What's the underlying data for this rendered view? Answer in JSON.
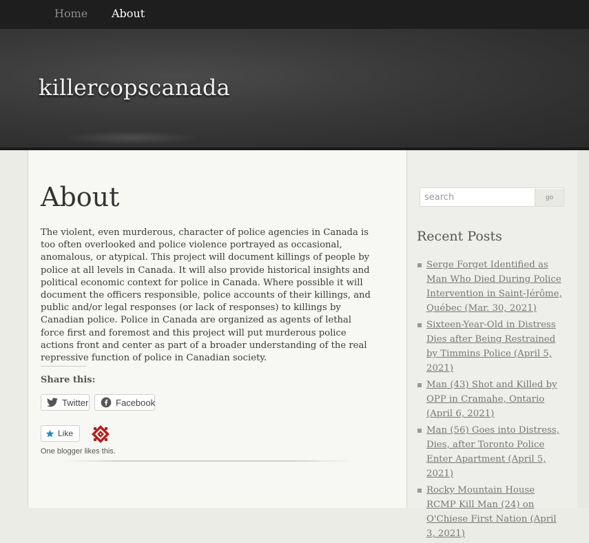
{
  "nav": {
    "items": [
      {
        "label": "Home"
      },
      {
        "label": "About"
      }
    ]
  },
  "header": {
    "site_title": "killercopscanada"
  },
  "main": {
    "page_title": "About",
    "body": "The violent, even murderous, character of police agencies in Canada is too often overlooked and police violence portrayed as occasional, anomalous, or atypical. This project will document killings of people by police at all levels in Canada. It will also provide historical insights and political economic context for police in Canada. Where possible it will document the officers responsible, police accounts of their killings, and public and/or legal responses (or lack of responses) to killings by Canadian police. Police in Canada are organized as agents of lethal force first and foremost and this project will put murderous police actions front and center as part of a broader understanding of the real repressive function of police in Canadian society.",
    "share": {
      "title": "Share this:",
      "twitter_label": "Twitter",
      "facebook_label": "Facebook"
    },
    "like": {
      "button_label": "Like",
      "likes_text": "One blogger likes this."
    }
  },
  "sidebar": {
    "search": {
      "placeholder": "search",
      "button_label": "go"
    },
    "recent_posts": {
      "title": "Recent Posts",
      "items": [
        {
          "label": "Serge Forget Identified as Man Who Died During Police Intervention in Saint-Jérôme, Québec (Mar. 30, 2021)"
        },
        {
          "label": "Sixteen-Year-Old in Distress Dies after Being Restrained by Timmins Police (April 5, 2021)"
        },
        {
          "label": "Man (43) Shot and Killed by OPP in Cramahe, Ontario (April 6, 2021)"
        },
        {
          "label": "Man (56) Goes into Distress, Dies, after Toronto Police Enter Apartment (April 5, 2021)"
        },
        {
          "label": "Rocky Mountain House RCMP Kill Man (24) on O'Chiese First Nation (April 3, 2021)"
        }
      ]
    }
  },
  "colors": {
    "nav_bg": "#1e1e1e",
    "header_bg": "#3a3a3a",
    "content_bg": "#f7f7f4",
    "link": "#777777",
    "twitter_icon": "#555555",
    "facebook_icon": "#555555",
    "like_star": "#1e8cbe",
    "avatar": "#b51e1e"
  },
  "icons": {
    "twitter": "twitter-icon",
    "facebook": "facebook-icon",
    "like": "star-icon",
    "avatar": "avatar-pattern-icon"
  }
}
